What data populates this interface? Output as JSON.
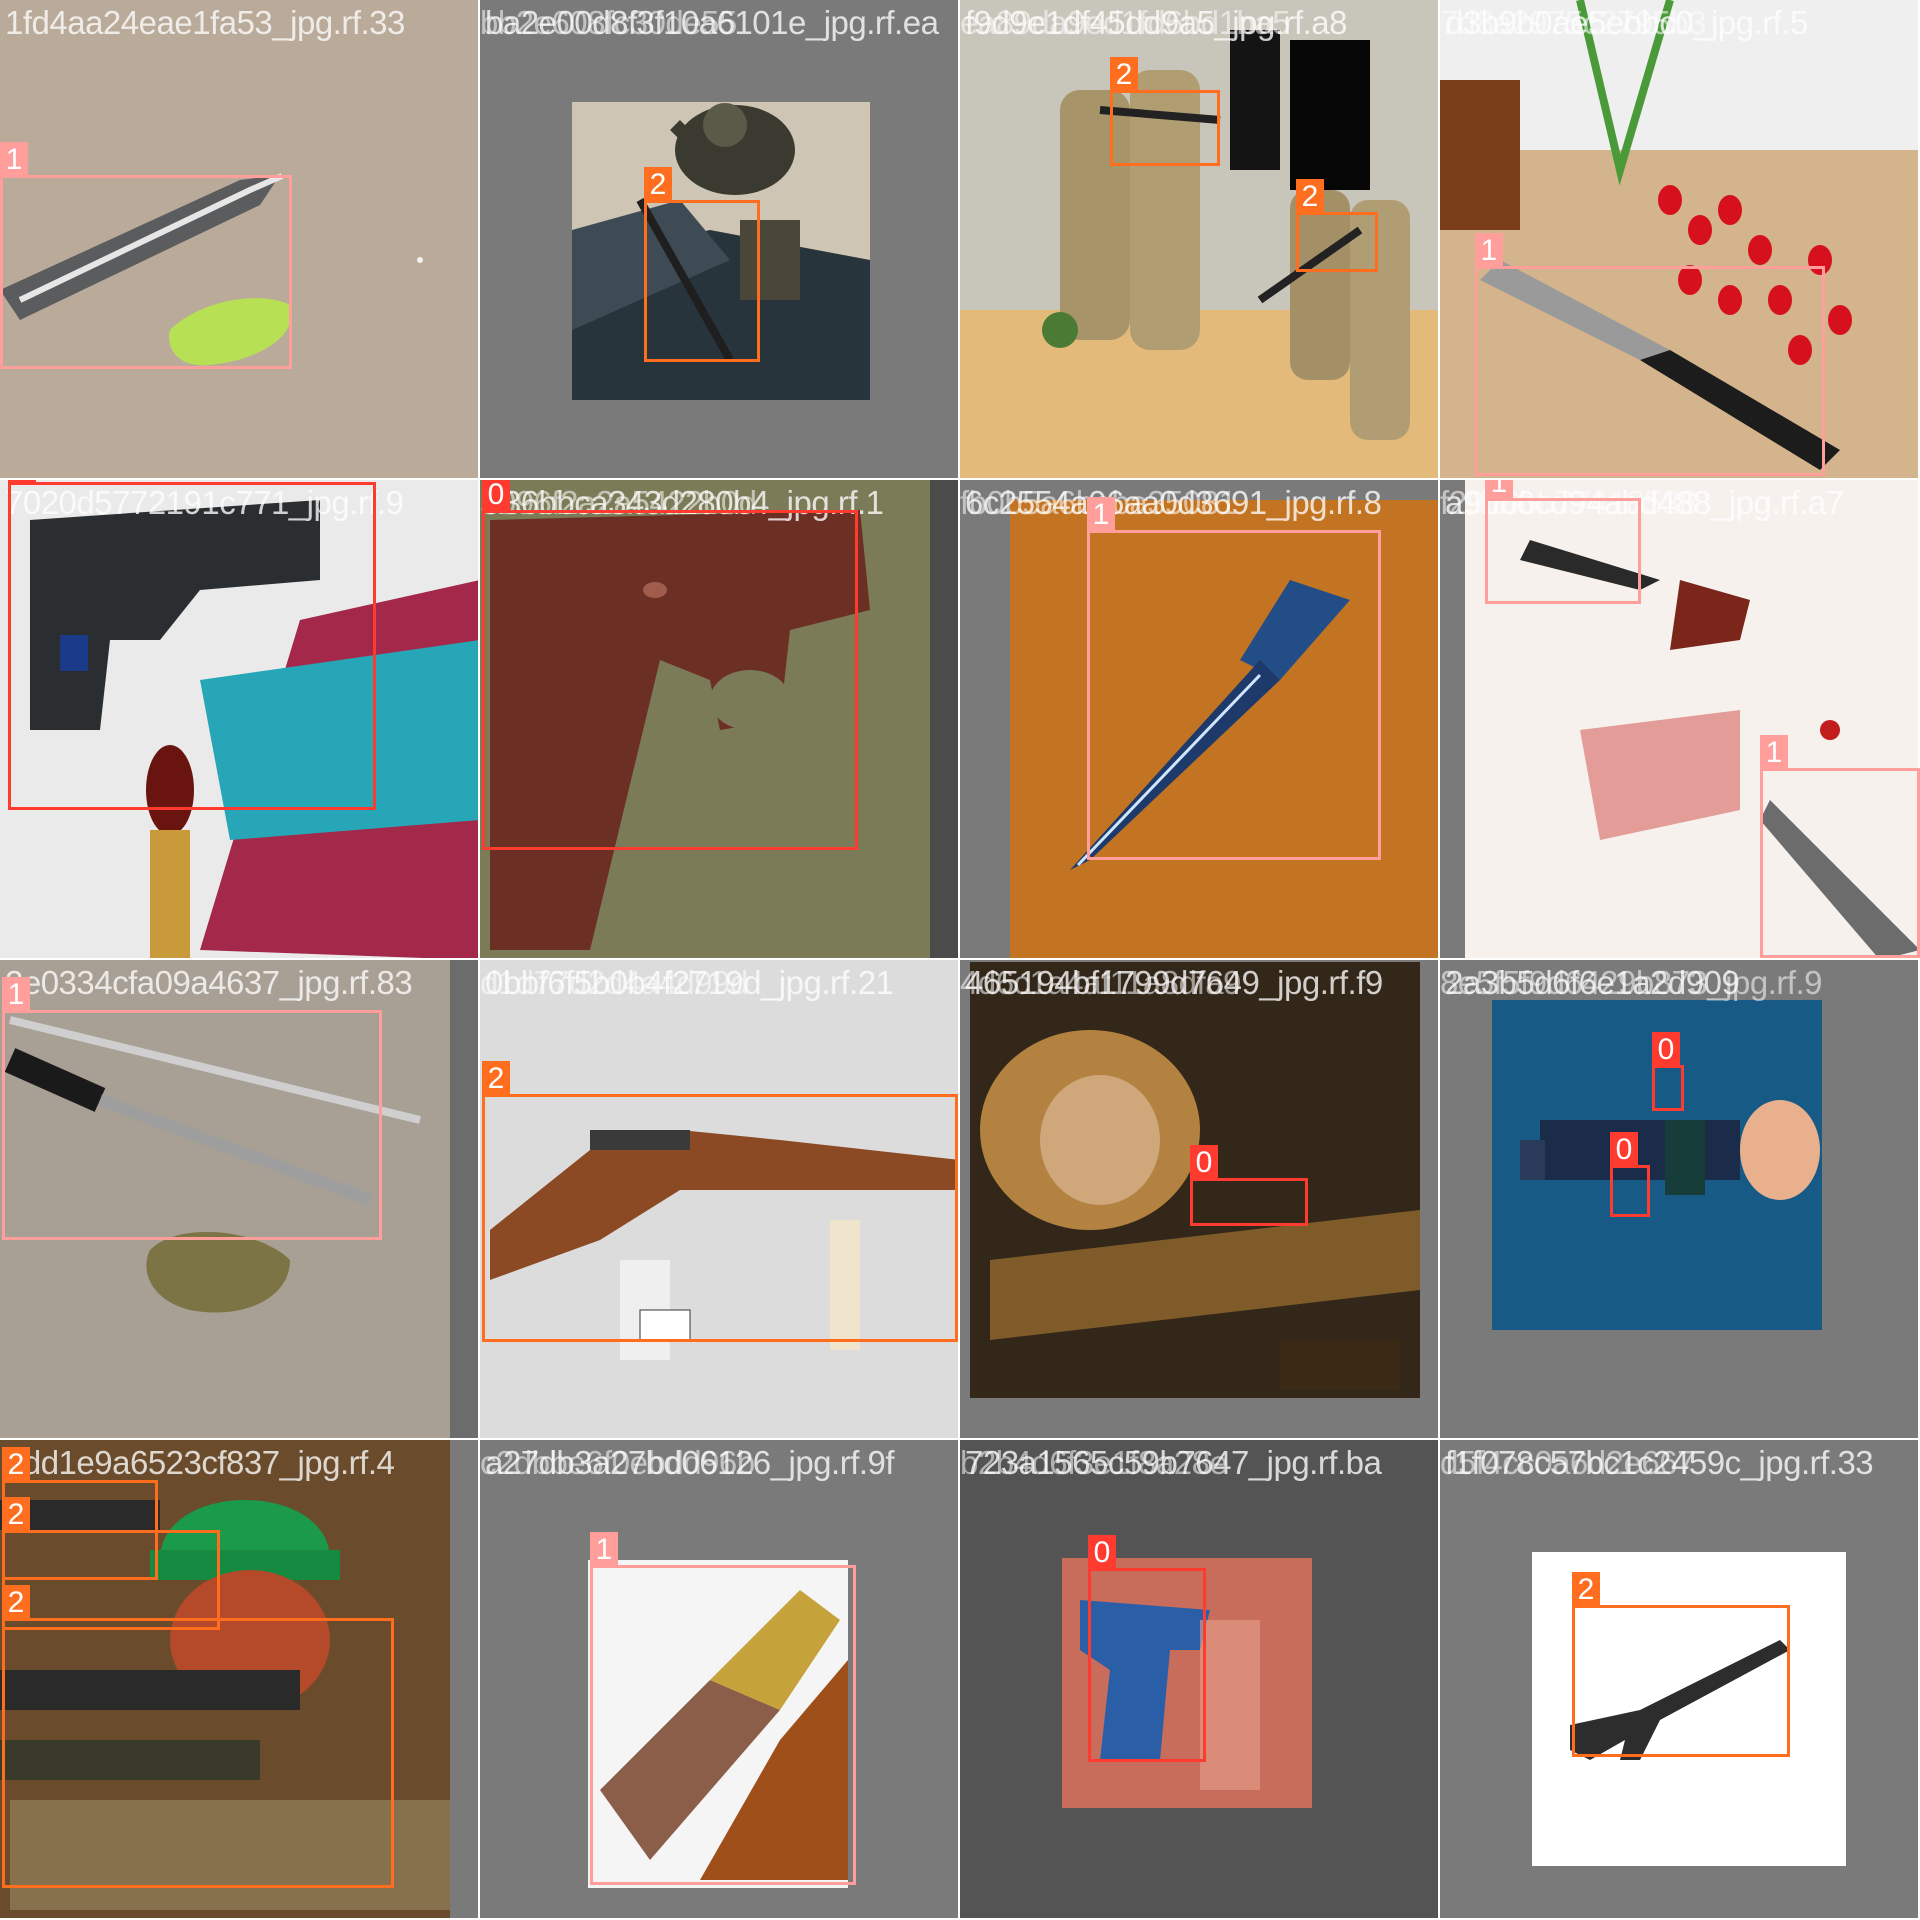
{
  "colors": {
    "class_0": "#ff3b30",
    "class_1": "#ff9e9a",
    "class_2": "#ff6e1f",
    "gray_pad": "#7a7a7a",
    "label_text": "#ffffff"
  },
  "tiles": [
    {
      "names": [
        "1fd4aa24eae1fa53_jpg.rf.33"
      ],
      "labels": [
        "1"
      ],
      "scene": "knife-with-lime"
    },
    {
      "names": [
        "bb2e608fc30de55",
        "ba2e00d8f3f10a6101e_jpg.rf.ea"
      ],
      "labels": [
        "2"
      ],
      "scene": "soldier-in-helicopter"
    },
    {
      "names": [
        "f9d9e1df45dd9a5_jpg.rf.a8",
        "ea89da9ed1fd6bd1ba5"
      ],
      "labels": [
        "2",
        "2"
      ],
      "scene": "soldiers-at-building"
    },
    {
      "names": [
        "7d8a2975c2795b3",
        "d3b9b0ae5ebbc0_jpg.rf.5"
      ],
      "labels": [
        "1"
      ],
      "scene": "chef-knife-tomatoes"
    },
    {
      "names": [
        "7020d5772191c771_jpg.rf.9"
      ],
      "labels": [
        "0"
      ],
      "scene": "pistol-super-bowl"
    },
    {
      "names": [
        "3096f2a2a5422b0d",
        "a36bbca343d280b4_jpg.rf.1"
      ],
      "labels": [
        "0"
      ],
      "scene": "brown-pistol"
    },
    {
      "names": [
        "6c2554a06aa0d3691_jpg.rf.8",
        "fb0b5a6baba35081"
      ],
      "labels": [
        "1"
      ],
      "scene": "blue-dagger"
    },
    {
      "names": [
        "f29ff6bb77418538",
        "a9bb6cd94abd488_jpg.rf.a7"
      ],
      "labels": [
        "1",
        "1"
      ],
      "scene": "steak-plate"
    },
    {
      "names": [
        "2e0334cfa09a4637_jpg.rf.83"
      ],
      "labels": [
        "1"
      ],
      "scene": "knife-fork-plate"
    },
    {
      "names": [
        "0bbf6f5b0b4f2719d_jpg.rf.21",
        "d1d77d2d4a4d99d"
      ],
      "labels": [
        "2"
      ],
      "scene": "bolt-action-rifle"
    },
    {
      "names": [
        "465194bf1799d7649_jpg.rf.f9",
        "4d6c1a4af11a8dfa9"
      ],
      "labels": [
        "0"
      ],
      "scene": "mad-max-poster"
    },
    {
      "names": [
        "8e5f5f9d6429b873_jpg.rf.9",
        "2a3b5d6f6e1a2d909"
      ],
      "labels": [
        "0",
        "0"
      ],
      "scene": "cartoon-man"
    },
    {
      "names": [
        "2dd1e9a6523cf837_jpg.rf.4"
      ],
      "labels": [
        "2",
        "2",
        "2"
      ],
      "scene": "sniper-range"
    },
    {
      "names": [
        "a27db3a27bd06126_jpg.rf.9f",
        "c2dbbe6f0ebdd96b"
      ],
      "labels": [
        "1"
      ],
      "scene": "knife-with-sheath"
    },
    {
      "names": [
        "723a1565c59b7647_jpg.rf.ba",
        "b2b4d6f3e1f8a28e"
      ],
      "labels": [
        "0"
      ],
      "scene": "blue-toy-pistol"
    },
    {
      "names": [
        "f1f078c57bc1c2459c_jpg.rf.33",
        "d5f4cc0a6d2e667"
      ],
      "labels": [
        "2"
      ],
      "scene": "shotgun"
    }
  ]
}
